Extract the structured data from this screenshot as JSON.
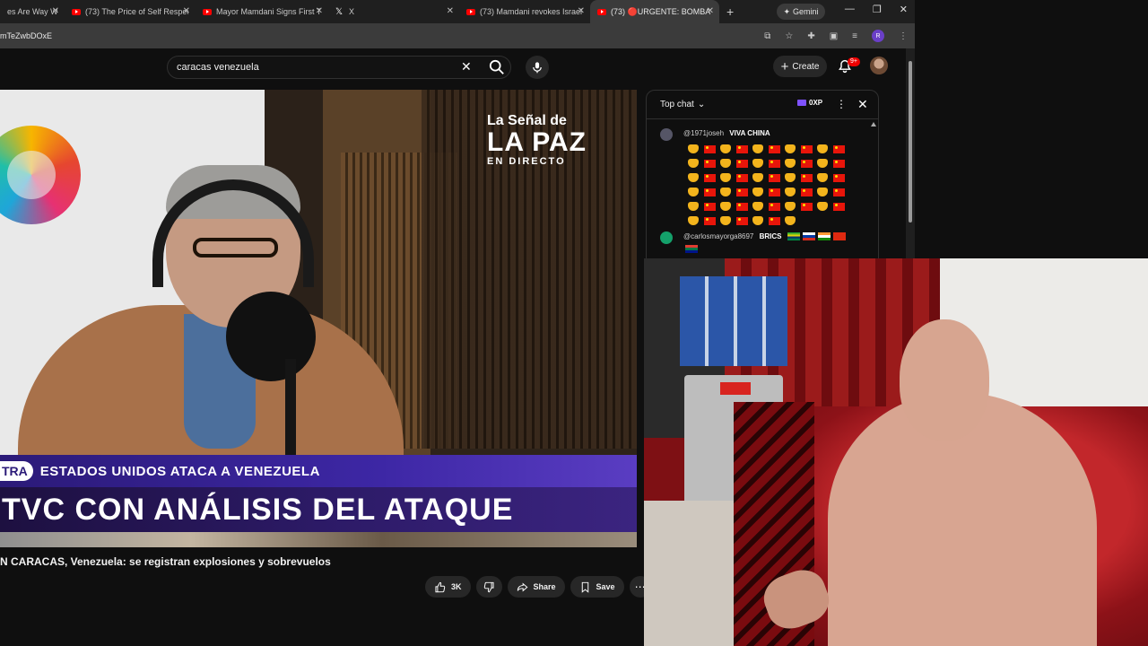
{
  "browser": {
    "tabs": [
      {
        "label": "es Are Way W",
        "icon": "youtube-icon",
        "active": false
      },
      {
        "label": "(73) The Price of Self Respec",
        "icon": "youtube-icon",
        "active": false
      },
      {
        "label": "Mayor Mamdani Signs First T",
        "icon": "youtube-icon",
        "active": false
      },
      {
        "label": "X",
        "icon": "x-logo-icon",
        "active": false
      },
      {
        "label": "(73) Mamdani revokes Israel-",
        "icon": "youtube-icon",
        "active": false
      },
      {
        "label": "(73) 🔴URGENTE: BOMBA",
        "icon": "youtube-icon",
        "active": true
      }
    ],
    "gemini_label": "Gemini",
    "url": "mTeZwbDOxE",
    "profile_initial": "R"
  },
  "youtube": {
    "search_value": "caracas venezuela",
    "create_label": "Create",
    "notification_count": "9+"
  },
  "video": {
    "brand_line1": "La Señal de",
    "brand_line2": "LA PAZ",
    "brand_line3": "EN DIRECTO",
    "live_pill": "TRA",
    "kicker": "ESTADOS UNIDOS ATACA A VENEZUELA",
    "headline": "TVC CON ANÁLISIS DEL ATAQUE",
    "title": "N CARACAS, Venezuela: se registran explosiones y sobrevuelos",
    "likes": "3K",
    "share_label": "Share",
    "save_label": "Save"
  },
  "chat": {
    "header_label": "Top chat",
    "xp_label": "0XP",
    "messages": [
      {
        "author": "@1971joseh",
        "text": "VIVA CHINA"
      },
      {
        "author": "@carlosmayorga8697",
        "text": "BRICS"
      }
    ]
  }
}
